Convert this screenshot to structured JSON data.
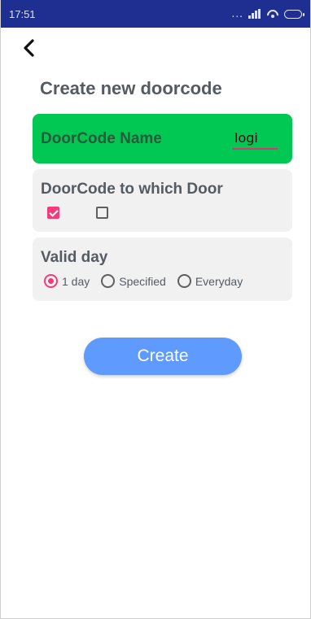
{
  "status_bar": {
    "time": "17:51",
    "dots": "...",
    "icons": [
      "signal-icon",
      "wifi-icon",
      "battery-icon"
    ]
  },
  "header": {
    "back_icon": "chevron-left-icon",
    "title": "Create new doorcode"
  },
  "name_card": {
    "label": "DoorCode Name",
    "input_value": "logi",
    "background": "#00c853"
  },
  "door_card": {
    "title": "DoorCode to which Door",
    "checkboxes": [
      {
        "checked": true
      },
      {
        "checked": false
      }
    ]
  },
  "valid_card": {
    "title": "Valid day",
    "options": [
      {
        "label": "1 day",
        "selected": true
      },
      {
        "label": "Specified",
        "selected": false
      },
      {
        "label": "Everyday",
        "selected": false
      }
    ]
  },
  "actions": {
    "create_label": "Create"
  },
  "colors": {
    "status_bar": "#1f2f91",
    "accent": "#f23b7a",
    "button": "#5f9aff"
  }
}
